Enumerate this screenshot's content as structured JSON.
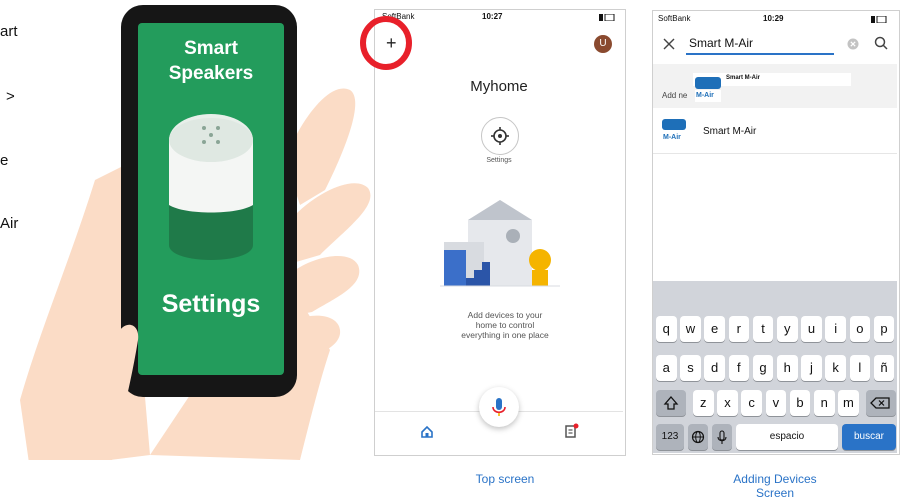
{
  "left_fragments": [
    "art",
    ">",
    "e",
    "Air"
  ],
  "hero_phone": {
    "title_line1": "Smart",
    "title_line2": "Speakers",
    "label": "Settings"
  },
  "phone_top": {
    "status": {
      "carrier": "SoftBank",
      "time": "10:27"
    },
    "add_label": "+",
    "avatar_letter": "U",
    "home_title": "Myhome",
    "settings_label": "Settings",
    "empty_text": [
      "Add devices to your",
      "home to control",
      "everything in one place"
    ]
  },
  "phone_search": {
    "status": {
      "carrier": "SoftBank",
      "time": "10:29"
    },
    "search_value": "Smart M-Air",
    "suggestion_prefix": "Add ne",
    "suggestion_brand": "Smart M-Air",
    "logo_text": "M-Air",
    "result_label": "Smart M-Air",
    "keyboard": {
      "row1": [
        "q",
        "w",
        "e",
        "r",
        "t",
        "y",
        "u",
        "i",
        "o",
        "p"
      ],
      "row2": [
        "a",
        "s",
        "d",
        "f",
        "g",
        "h",
        "j",
        "k",
        "l",
        "ñ"
      ],
      "row3": [
        "z",
        "x",
        "c",
        "v",
        "b",
        "n",
        "m"
      ],
      "num_key": "123",
      "space_key": "espacio",
      "search_key": "buscar"
    }
  },
  "captions": {
    "top": "Top screen",
    "add_line1": "Adding Devices",
    "add_line2": "Screen"
  },
  "colors": {
    "hero_green": "#239c5c",
    "accent_blue": "#2a73c7",
    "highlight_red": "#e8202a",
    "hand": "#fbdcc6"
  }
}
